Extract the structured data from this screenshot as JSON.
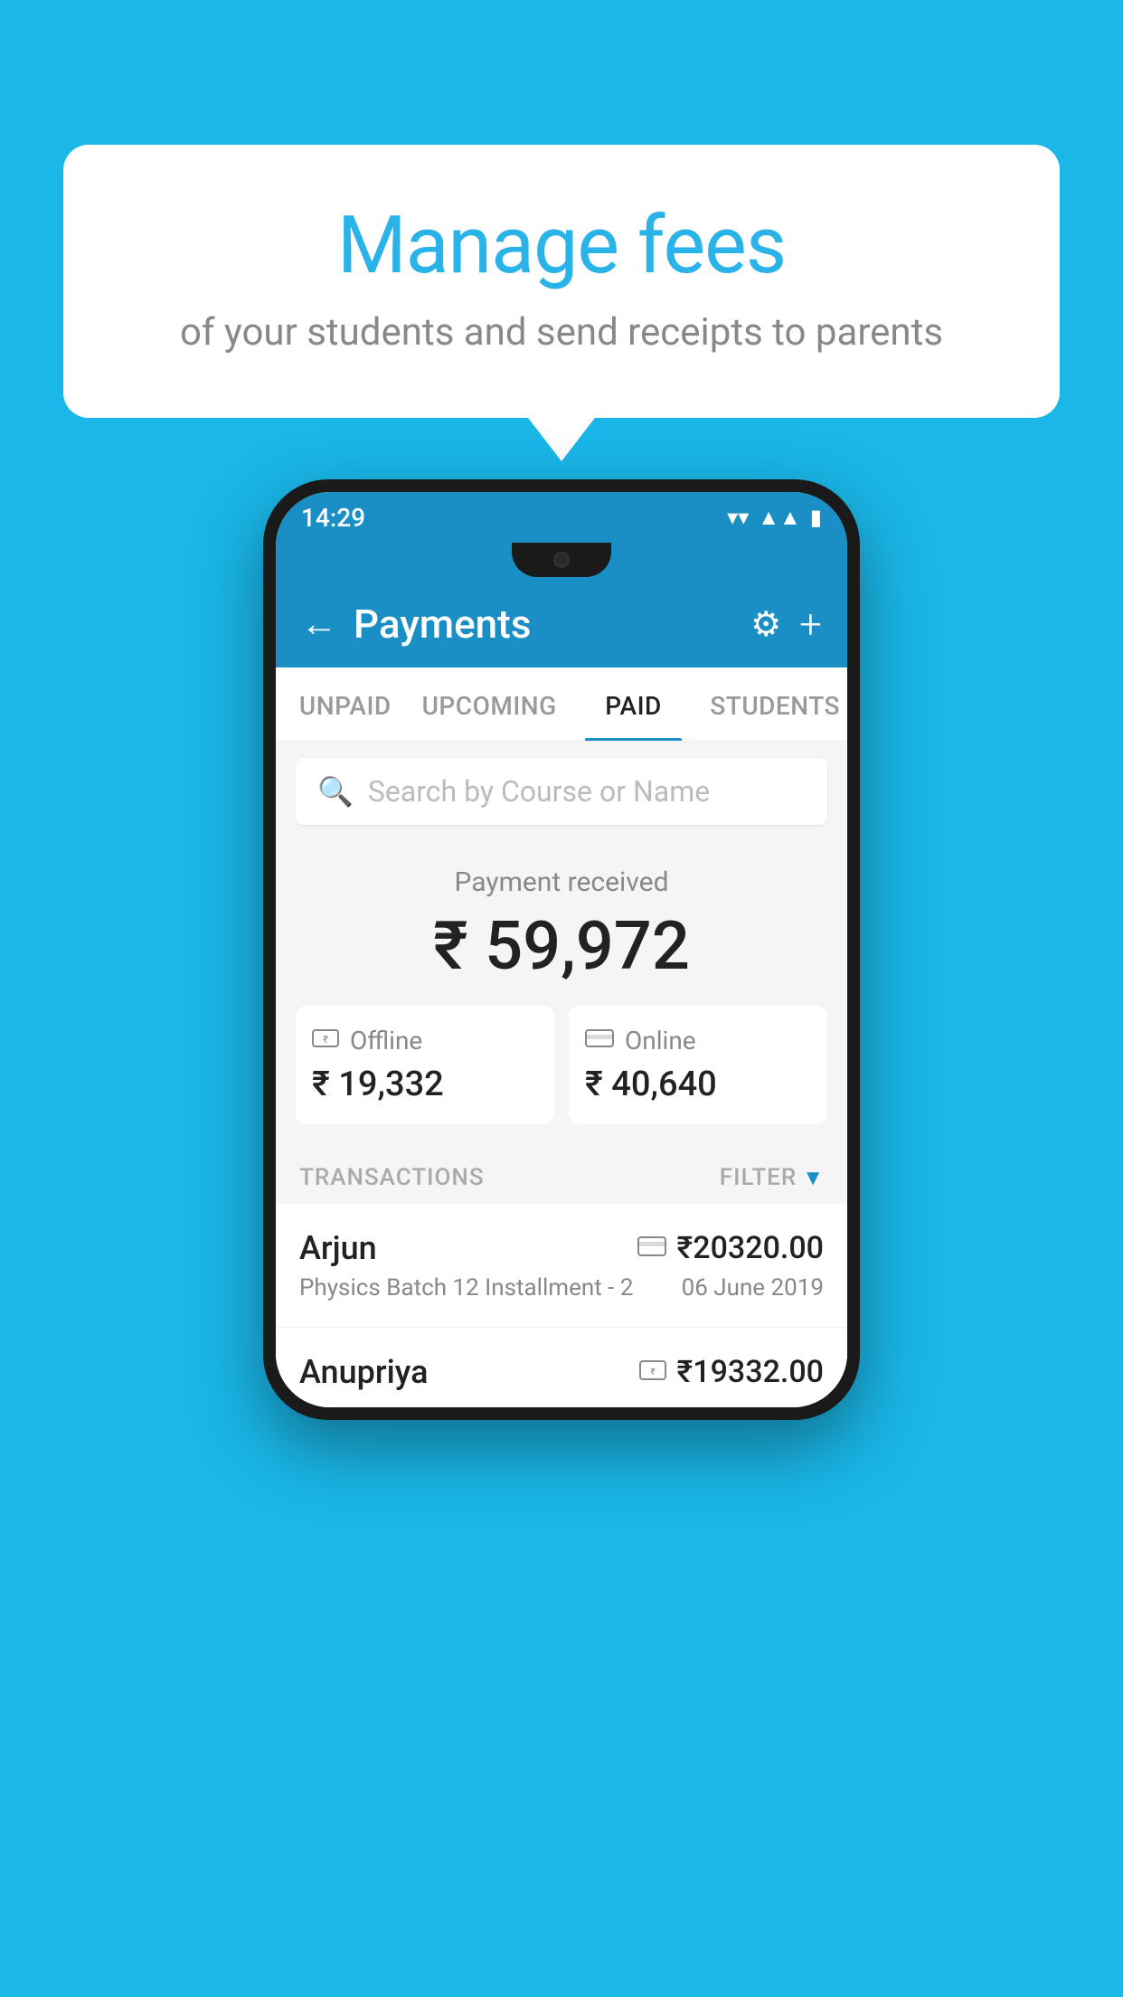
{
  "background_color": "#1ab7e8",
  "speech_bubble": {
    "title": "Manage fees",
    "subtitle": "of your students and send receipts to parents"
  },
  "status_bar": {
    "time": "14:29",
    "wifi_icon": "▲",
    "signal_icon": "▲",
    "battery_icon": "▮"
  },
  "app_header": {
    "title": "Payments",
    "back_label": "←",
    "gear_label": "⚙",
    "plus_label": "+"
  },
  "tabs": [
    {
      "label": "UNPAID",
      "active": false
    },
    {
      "label": "UPCOMING",
      "active": false
    },
    {
      "label": "PAID",
      "active": true
    },
    {
      "label": "STUDENTS",
      "active": false
    }
  ],
  "search": {
    "placeholder": "Search by Course or Name"
  },
  "payment_summary": {
    "label": "Payment received",
    "amount": "₹ 59,972",
    "offline": {
      "label": "Offline",
      "amount": "₹ 19,332"
    },
    "online": {
      "label": "Online",
      "amount": "₹ 40,640"
    }
  },
  "transactions": {
    "section_label": "TRANSACTIONS",
    "filter_label": "FILTER",
    "items": [
      {
        "name": "Arjun",
        "course": "Physics Batch 12 Installment - 2",
        "amount": "₹20320.00",
        "date": "06 June 2019",
        "payment_type": "card"
      },
      {
        "name": "Anupriya",
        "course": "",
        "amount": "₹19332.00",
        "date": "",
        "payment_type": "offline"
      }
    ]
  }
}
